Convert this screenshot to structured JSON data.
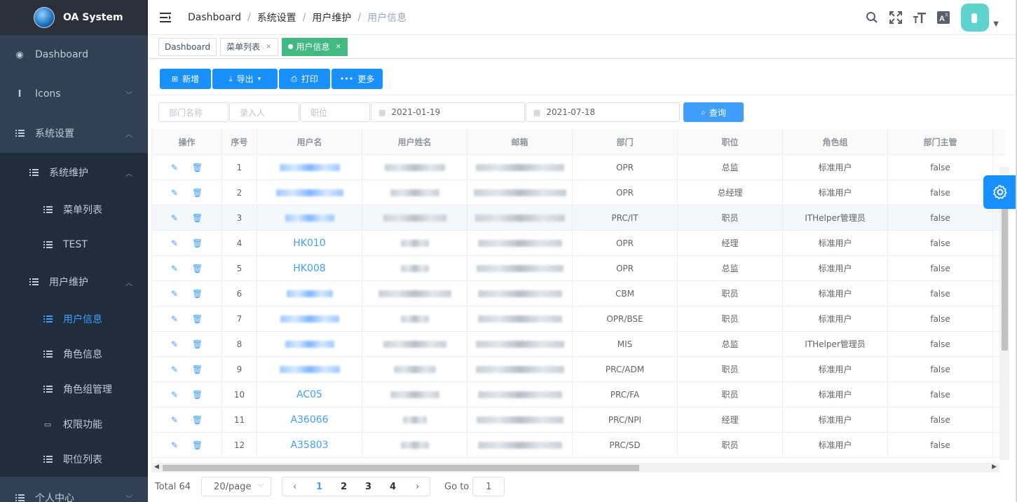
{
  "app": {
    "title": "OA System"
  },
  "sidebar": {
    "items": [
      {
        "label": "Dashboard",
        "icon": "dashboard-icon"
      },
      {
        "label": "Icons",
        "icon": "info-icon"
      },
      {
        "label": "系统设置",
        "icon": "list-icon"
      },
      {
        "label": "系统维护",
        "icon": "list-icon"
      },
      {
        "label": "菜单列表",
        "icon": "list-icon"
      },
      {
        "label": "TEST",
        "icon": "list-icon"
      },
      {
        "label": "用户维护",
        "icon": "list-icon"
      },
      {
        "label": "用户信息",
        "icon": "list-icon"
      },
      {
        "label": "角色信息",
        "icon": "list-icon"
      },
      {
        "label": "角色组管理",
        "icon": "list-icon"
      },
      {
        "label": "权限功能",
        "icon": "message-icon"
      },
      {
        "label": "职位列表",
        "icon": "list-icon"
      },
      {
        "label": "个人中心",
        "icon": "list-icon"
      }
    ]
  },
  "breadcrumb": [
    "Dashboard",
    "系统设置",
    "用户维护",
    "用户信息"
  ],
  "tags": [
    {
      "label": "Dashboard"
    },
    {
      "label": "菜单列表",
      "close": "×"
    },
    {
      "label": "用户信息",
      "close": "×"
    }
  ],
  "toolbar": {
    "add": "新增",
    "export": "导出",
    "print": "打印",
    "more": "更多"
  },
  "filters": {
    "dept_placeholder": "部门名称",
    "entry_placeholder": "录入人",
    "position_placeholder": "职位",
    "date_start": "2021-01-19",
    "date_end": "2021-07-18",
    "query": "查询"
  },
  "table": {
    "headers": [
      "操作",
      "序号",
      "用户名",
      "用户姓名",
      "邮箱",
      "部门",
      "职位",
      "角色组",
      "部门主管"
    ],
    "rows": [
      {
        "no": "1",
        "user": "",
        "dept": "OPR",
        "pos": "总监",
        "role": "标准用户",
        "mgr": "false"
      },
      {
        "no": "2",
        "user": "",
        "dept": "OPR",
        "pos": "总经理",
        "role": "标准用户",
        "mgr": "false"
      },
      {
        "no": "3",
        "user": "",
        "dept": "PRC/IT",
        "pos": "职员",
        "role": "ITHelper管理员",
        "mgr": "false"
      },
      {
        "no": "4",
        "user": "HK010",
        "dept": "OPR",
        "pos": "经理",
        "role": "标准用户",
        "mgr": "false"
      },
      {
        "no": "5",
        "user": "HK008",
        "dept": "OPR",
        "pos": "总监",
        "role": "标准用户",
        "mgr": "false"
      },
      {
        "no": "6",
        "user": "",
        "dept": "CBM",
        "pos": "职员",
        "role": "标准用户",
        "mgr": "false"
      },
      {
        "no": "7",
        "user": "",
        "dept": "OPR/BSE",
        "pos": "职员",
        "role": "标准用户",
        "mgr": "false"
      },
      {
        "no": "8",
        "user": "",
        "dept": "MIS",
        "pos": "总监",
        "role": "ITHelper管理员",
        "mgr": "false"
      },
      {
        "no": "9",
        "user": "",
        "dept": "PRC/ADM",
        "pos": "职员",
        "role": "标准用户",
        "mgr": "false"
      },
      {
        "no": "10",
        "user": "AC05",
        "dept": "PRC/FA",
        "pos": "职员",
        "role": "标准用户",
        "mgr": "false"
      },
      {
        "no": "11",
        "user": "A36066",
        "dept": "PRC/NPI",
        "pos": "经理",
        "role": "标准用户",
        "mgr": "false"
      },
      {
        "no": "12",
        "user": "A35803",
        "dept": "PRC/SD",
        "pos": "职员",
        "role": "标准用户",
        "mgr": "false"
      }
    ]
  },
  "pagination": {
    "total": "Total 64",
    "page_size": "20/page",
    "pages": [
      "1",
      "2",
      "3",
      "4"
    ],
    "current": "1",
    "goto_label": "Go to",
    "goto_value": "1"
  },
  "colors": {
    "sidebar_bg": "#304156",
    "accent": "#409eff",
    "active_tag": "#42b983",
    "button": "#1890ff"
  }
}
